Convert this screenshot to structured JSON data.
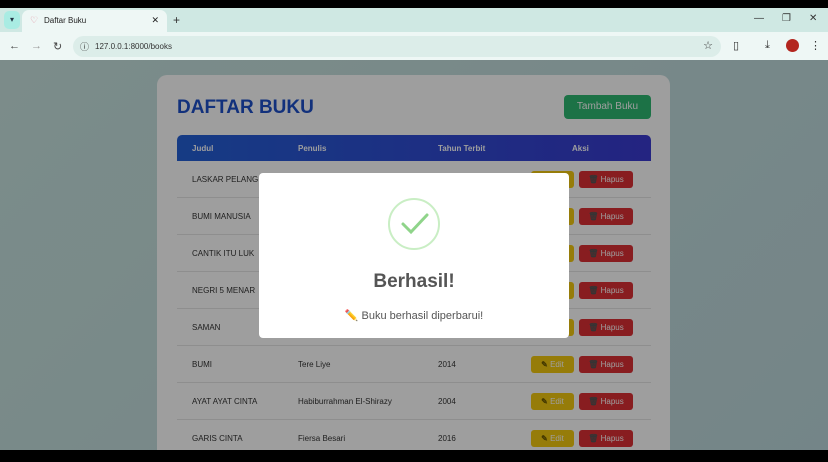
{
  "browser": {
    "tab_title": "Daftar Buku",
    "url": "127.0.0.1:8000/books",
    "icons": [
      "tab-list-icon",
      "favicon",
      "close-icon",
      "new-tab-icon",
      "minimize-icon",
      "restore-icon",
      "close-window-icon",
      "back-icon",
      "forward-icon",
      "reload-icon",
      "site-info-icon",
      "star-icon",
      "extensions-icon",
      "download-icon",
      "profile-avatar",
      "menu-icon"
    ]
  },
  "page": {
    "title": "DAFTAR BUKU",
    "add_button": "Tambah Buku",
    "columns": [
      "Judul",
      "Penulis",
      "Tahun Terbit",
      "Aksi"
    ],
    "edit_label": "Edit",
    "delete_label": "Hapus",
    "rows": [
      {
        "judul": "LASKAR PELANG",
        "penulis": "",
        "tahun": ""
      },
      {
        "judul": "BUMI MANUSIA",
        "penulis": "",
        "tahun": ""
      },
      {
        "judul": "CANTIK ITU LUK",
        "penulis": "",
        "tahun": ""
      },
      {
        "judul": "NEGRI 5 MENAR",
        "penulis": "",
        "tahun": ""
      },
      {
        "judul": "SAMAN",
        "penulis": "",
        "tahun": ""
      },
      {
        "judul": "BUMI",
        "penulis": "Tere Liye",
        "tahun": "2014"
      },
      {
        "judul": "AYAT AYAT CINTA",
        "penulis": "Habiburrahman El-Shirazy",
        "tahun": "2004"
      },
      {
        "judul": "GARIS CINTA",
        "penulis": "Fiersa Besari",
        "tahun": "2016"
      }
    ]
  },
  "modal": {
    "title": "Berhasil!",
    "message": "Buku berhasil diperbarui!",
    "icon": "success-check-icon"
  },
  "colors": {
    "primary": "#1e4fc9",
    "success": "#2eb872",
    "warning": "#f2c80f",
    "danger": "#dc3035"
  }
}
